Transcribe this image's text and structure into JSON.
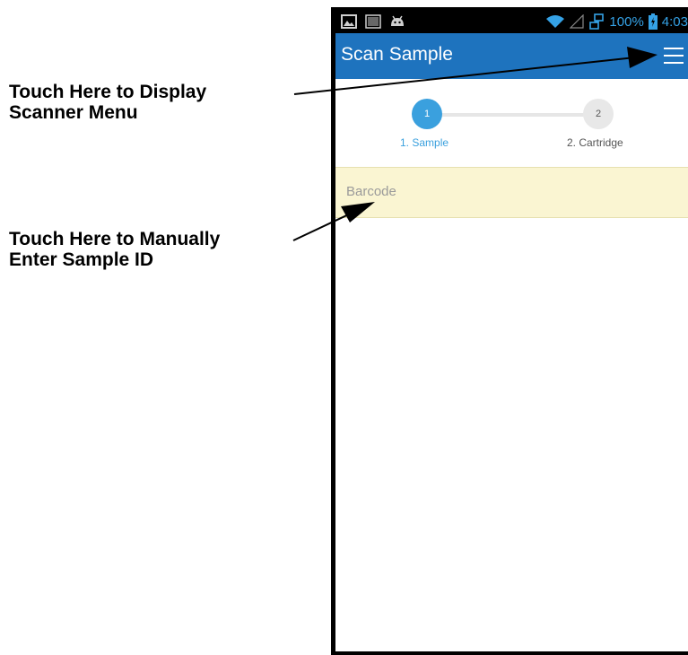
{
  "callouts": {
    "menu": {
      "line1": "Touch Here to Display",
      "line2": "Scanner Menu"
    },
    "barcode": {
      "line1": "Touch Here to Manually",
      "line2": "Enter Sample ID"
    }
  },
  "status_bar": {
    "left_icons": [
      "image-icon",
      "barcode-icon",
      "android-icon"
    ],
    "right_icons": [
      "wifi-icon",
      "no-signal-icon",
      "usb-icon"
    ],
    "battery_percent": "100%",
    "battery_icon": "battery-charging-icon",
    "time": "4:03"
  },
  "app_bar": {
    "title": "Scan Sample",
    "menu_icon": "hamburger-menu-icon"
  },
  "stepper": {
    "steps": [
      {
        "number": "1",
        "label": "1. Sample",
        "active": true
      },
      {
        "number": "2",
        "label": "2. Cartridge",
        "active": false
      }
    ]
  },
  "barcode": {
    "placeholder": "Barcode",
    "value": ""
  },
  "colors": {
    "status_bar": "#000000",
    "status_icons": "#35a2e6",
    "app_bar": "#1e73be",
    "step_active": "#3aa0de",
    "step_inactive": "#e8e8e8",
    "barcode_field": "#faf5d2"
  }
}
